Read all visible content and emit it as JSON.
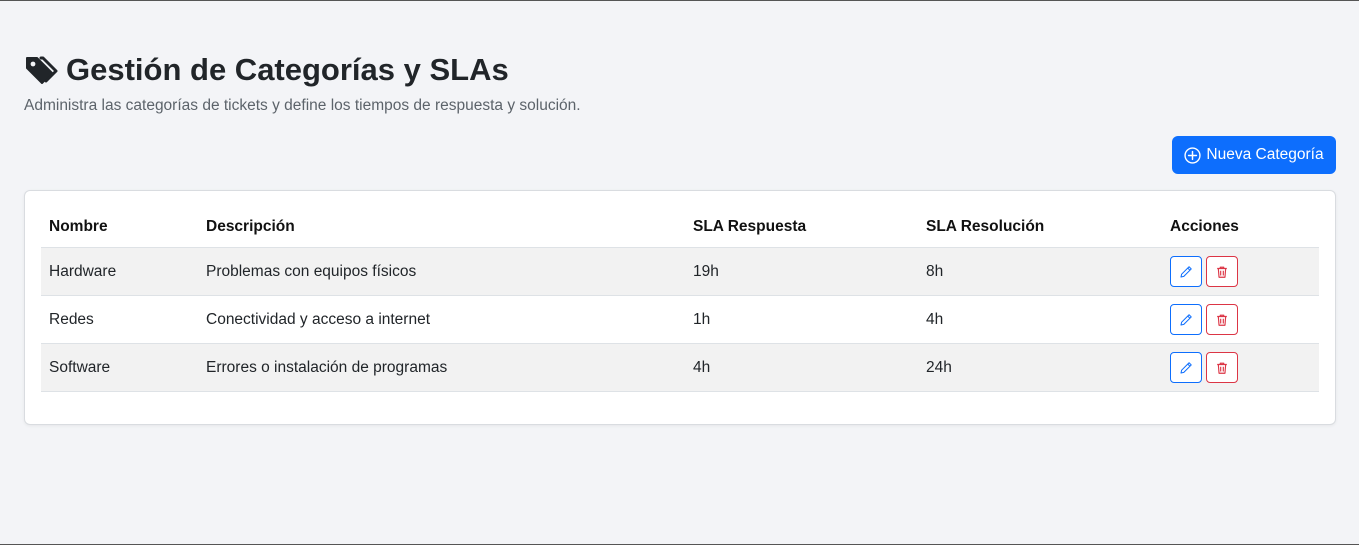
{
  "page": {
    "title": "Gestión de Categorías y SLAs",
    "subtitle": "Administra las categorías de tickets y define los tiempos de respuesta y solución.",
    "icon": "tags-icon"
  },
  "toolbar": {
    "new_button_label": "Nueva Categoría",
    "new_button_icon": "plus-circle-icon"
  },
  "table": {
    "headers": [
      "Nombre",
      "Descripción",
      "SLA Respuesta",
      "SLA Resolución",
      "Acciones"
    ],
    "rows": [
      {
        "nombre": "Hardware",
        "descripcion": "Problemas con equipos físicos",
        "sla_respuesta": "19h",
        "sla_resolucion": "8h"
      },
      {
        "nombre": "Redes",
        "descripcion": "Conectividad y acceso a internet",
        "sla_respuesta": "1h",
        "sla_resolucion": "4h"
      },
      {
        "nombre": "Software",
        "descripcion": "Errores o instalación de programas",
        "sla_respuesta": "4h",
        "sla_resolucion": "24h"
      }
    ],
    "row_actions": [
      "pencil-icon",
      "trash-icon"
    ]
  },
  "colors": {
    "primary": "#0d6efd",
    "danger": "#dc3545",
    "background": "#f3f4f7",
    "text": "#212529"
  }
}
